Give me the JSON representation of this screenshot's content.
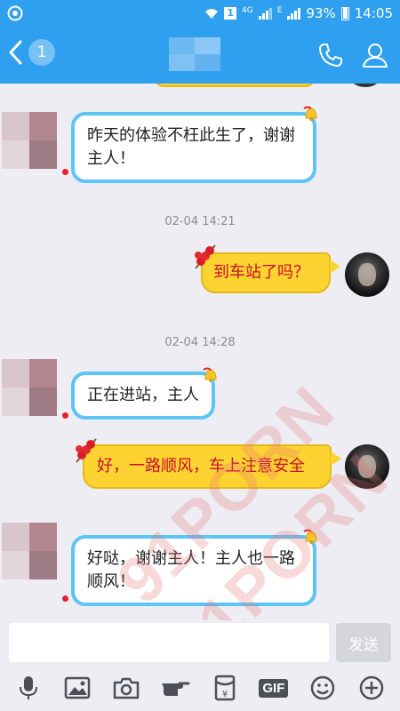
{
  "status_bar": {
    "icon_left": "notification-target-icon",
    "wifi": "wifi-icon",
    "sim_badge": "1",
    "network_type": "4G",
    "network_e": "E",
    "battery": "93%",
    "time": "14:05"
  },
  "header": {
    "back_badge": "1",
    "title_obscured": true,
    "icons": [
      "phone-icon",
      "person-icon"
    ]
  },
  "messages": [
    {
      "side": "in",
      "style": "blue",
      "text": "昨天的体验不枉此生了，谢谢主人！"
    },
    {
      "type": "timestamp",
      "text": "02-04 14:21"
    },
    {
      "side": "out",
      "style": "yellow",
      "text": "到车站了吗？"
    },
    {
      "type": "timestamp",
      "text": "02-04 14:28"
    },
    {
      "side": "in",
      "style": "blue",
      "text": "正在进站，主人"
    },
    {
      "side": "out",
      "style": "yellow",
      "text": "好，一路顺风，车上注意安全"
    },
    {
      "side": "in",
      "style": "blue",
      "text": "好哒，谢谢主人！主人也一路顺风！"
    }
  ],
  "watermark": [
    "91PORN",
    "91PORN"
  ],
  "input": {
    "placeholder": "",
    "value": "",
    "send_label": "发送"
  },
  "toolbar": {
    "icons": [
      "microphone-icon",
      "image-icon",
      "camera-icon",
      "hand-gesture-icon",
      "red-packet-icon",
      "gif-icon",
      "emoji-icon",
      "plus-icon"
    ],
    "gif_label": "GIF"
  },
  "colors": {
    "header": "#2fa0f0",
    "bubble_blue_border": "#5cc4f7",
    "bubble_yellow": "#fcd330",
    "yellow_text": "#c8102e"
  }
}
